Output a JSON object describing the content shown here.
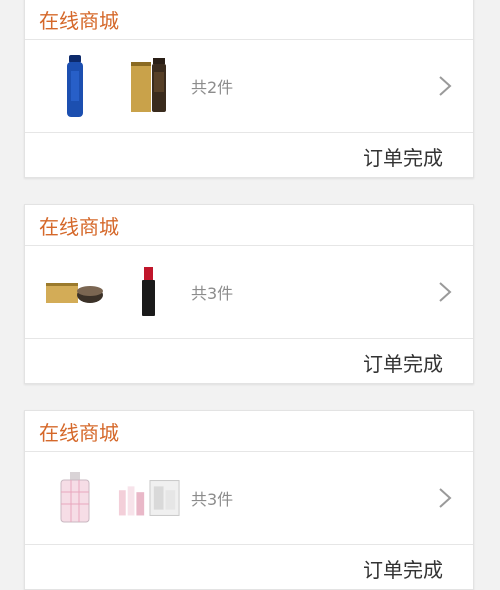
{
  "orders": [
    {
      "store": "在线商城",
      "count_text": "共2件",
      "status": "订单完成",
      "products": [
        "blue-serum-bottle-icon",
        "gold-tall-box-icon"
      ]
    },
    {
      "store": "在线商城",
      "count_text": "共3件",
      "status": "订单完成",
      "products": [
        "gold-jar-box-icon",
        "black-lipstick-icon"
      ]
    },
    {
      "store": "在线商城",
      "count_text": "共3件",
      "status": "订单完成",
      "products": [
        "pink-perfume-bottle-icon",
        "skincare-set-icon"
      ]
    }
  ],
  "colors": {
    "accent": "#d5682a",
    "text": "#333333",
    "muted": "#8c8c8c",
    "background": "#f2f2f2"
  },
  "icons": {
    "row_arrow": "chevron-right-icon"
  }
}
